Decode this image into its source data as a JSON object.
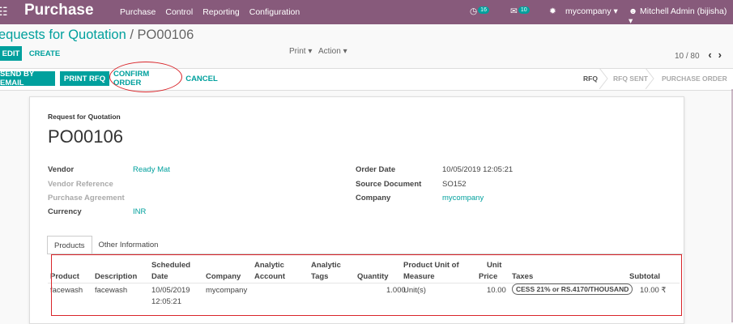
{
  "topbar": {
    "apps_icon": "grid-icon",
    "app_name": "Purchase",
    "menu": [
      "Purchase",
      "Control",
      "Reporting",
      "Configuration"
    ],
    "activity_count": "16",
    "message_count": "10",
    "company": "mycompany",
    "user": "Mitchell Admin (bijisha)"
  },
  "breadcrumb": {
    "parent": "equests for Quotation",
    "separator": "/",
    "current": "PO00106"
  },
  "control": {
    "edit": "EDIT",
    "create": "CREATE",
    "print": "Print",
    "action": "Action",
    "pager": "10 / 80"
  },
  "header_buttons": {
    "send_by_email": "SEND BY EMAIL",
    "print_rfq": "PRINT RFQ",
    "confirm_order": "CONFIRM ORDER",
    "cancel": "CANCEL"
  },
  "stages": [
    "RFQ",
    "RFQ SENT",
    "PURCHASE ORDER"
  ],
  "form": {
    "doc_type": "Request for Quotation",
    "number": "PO00106",
    "left": {
      "vendor_label": "Vendor",
      "vendor_value": "Ready Mat",
      "vendor_ref_label": "Vendor Reference",
      "agreement_label": "Purchase Agreement",
      "currency_label": "Currency",
      "currency_value": "INR"
    },
    "right": {
      "order_date_label": "Order Date",
      "order_date_value": "10/05/2019 12:05:21",
      "source_label": "Source Document",
      "source_value": "SO152",
      "company_label": "Company",
      "company_value": "mycompany"
    }
  },
  "tabs": [
    "Products",
    "Other Information"
  ],
  "table": {
    "headers": {
      "product": "Product",
      "description": "Description",
      "scheduled_1": "Scheduled",
      "scheduled_2": "Date",
      "company": "Company",
      "analytic_account_1": "Analytic",
      "analytic_account_2": "Account",
      "analytic_tags_1": "Analytic",
      "analytic_tags_2": "Tags",
      "quantity": "Quantity",
      "uom_1": "Product Unit of",
      "uom_2": "Measure",
      "unit_price_1": "Unit",
      "unit_price_2": "Price",
      "taxes": "Taxes",
      "subtotal": "Subtotal"
    },
    "rows": [
      {
        "product": "facewash",
        "description": "facewash",
        "date_1": "10/05/2019",
        "date_2": "12:05:21",
        "company": "mycompany",
        "quantity": "1.000",
        "uom": "Unit(s)",
        "unit_price": "10.00",
        "tax": "CESS 21% or RS.4170/THOUSAND",
        "subtotal": "10.00 ₹"
      }
    ]
  }
}
